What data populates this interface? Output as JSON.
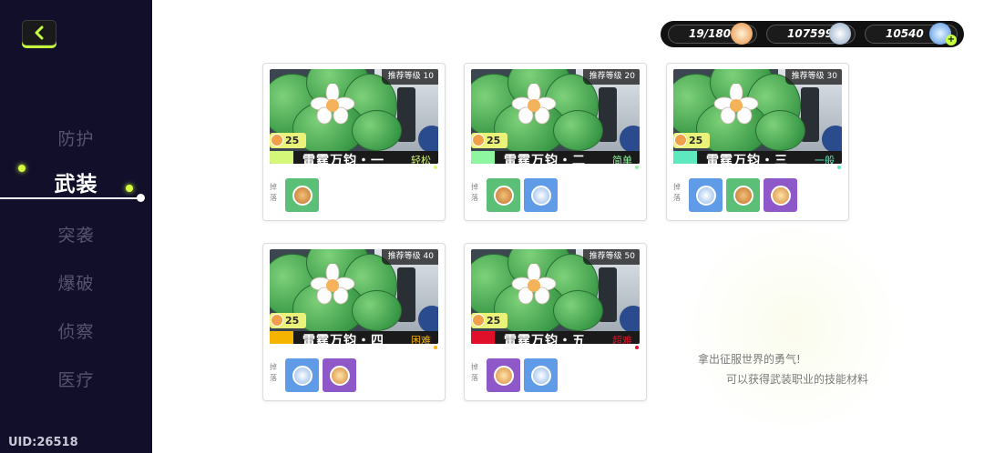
{
  "sidebar": {
    "back_icon": "chevron-left-icon",
    "items": [
      {
        "label": "防护",
        "active": false
      },
      {
        "label": "武装",
        "active": true
      },
      {
        "label": "突袭",
        "active": false
      },
      {
        "label": "爆破",
        "active": false
      },
      {
        "label": "侦察",
        "active": false
      },
      {
        "label": "医疗",
        "active": false
      }
    ],
    "uid": "UID:26518",
    "accent": "#c6ff3b"
  },
  "currency": [
    {
      "value": "19/180",
      "icon": "stamina-icon"
    },
    {
      "value": "1075998",
      "icon": "coin-icon"
    },
    {
      "value": "10540",
      "icon": "gem-icon"
    }
  ],
  "levels": [
    {
      "recommend": "推荐等级 10",
      "cost": "25",
      "name": "雷霆万钧・一",
      "difficulty": "轻松",
      "diff_color": "#d4f77a",
      "drops": [
        "bronze-medal",
        "none"
      ]
    },
    {
      "recommend": "推荐等级 20",
      "cost": "25",
      "name": "雷霆万钧・二",
      "difficulty": "简单",
      "diff_color": "#8ef5a0",
      "drops": [
        "bronze-medal",
        "blue-medal"
      ]
    },
    {
      "recommend": "推荐等级 30",
      "cost": "25",
      "name": "雷霆万钧・三",
      "difficulty": "一般",
      "diff_color": "#5ee8c0",
      "drops": [
        "blue-medal",
        "bronze-medal",
        "purple-medal"
      ]
    },
    {
      "recommend": "推荐等级 40",
      "cost": "25",
      "name": "雷霆万钧・四",
      "difficulty": "困难",
      "diff_color": "#f5b400",
      "drops": [
        "blue-medal",
        "purple-medal"
      ]
    },
    {
      "recommend": "推荐等级 50",
      "cost": "25",
      "name": "雷霆万钧・五",
      "difficulty": "超难",
      "diff_color": "#e0102a",
      "drops": [
        "purple-medal",
        "blue-medal"
      ]
    }
  ],
  "drop_label": "掉落",
  "hint": {
    "line1": "拿出征服世界的勇气!",
    "line2": "可以获得武装职业的技能材料"
  }
}
